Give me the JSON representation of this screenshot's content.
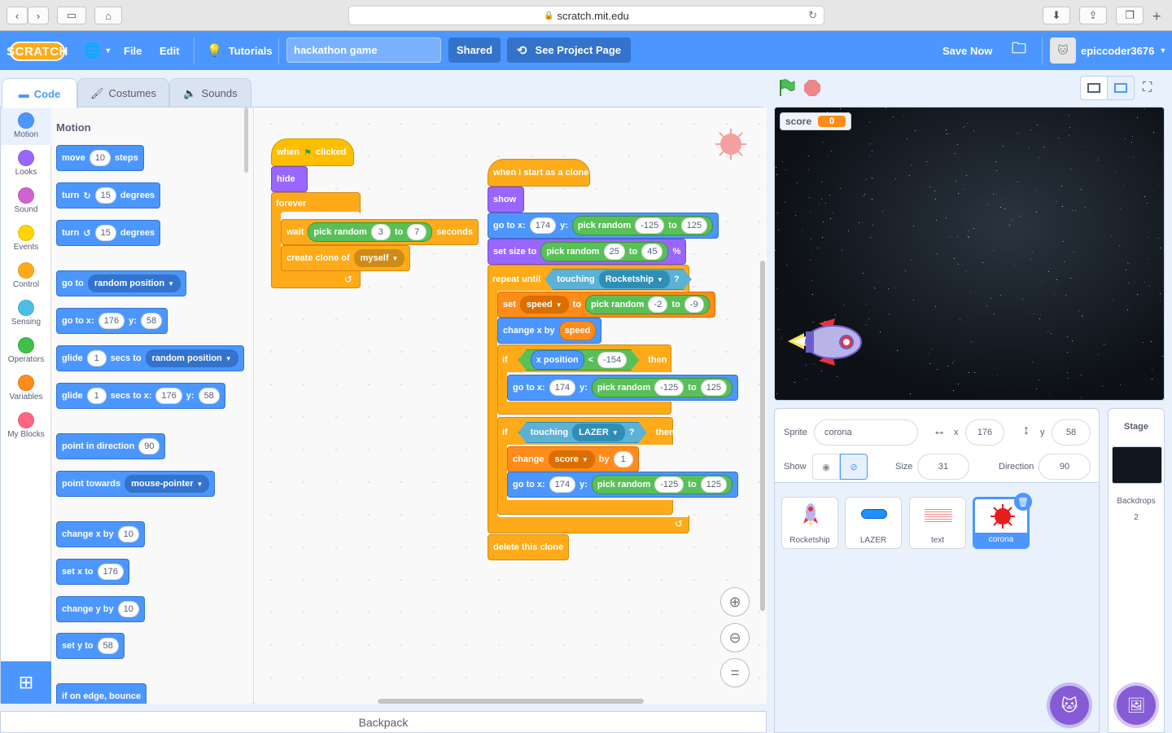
{
  "browser": {
    "url": "scratch.mit.edu"
  },
  "menu": {
    "logo": "SCRATCH",
    "file": "File",
    "edit": "Edit",
    "tutorials": "Tutorials",
    "project_title": "hackathon game",
    "shared": "Shared",
    "see_project": "See Project Page",
    "save_now": "Save Now",
    "username": "epiccoder3676"
  },
  "tabs": {
    "code": "Code",
    "costumes": "Costumes",
    "sounds": "Sounds"
  },
  "categories": [
    {
      "label": "Motion",
      "color": "#4c97ff"
    },
    {
      "label": "Looks",
      "color": "#9966ff"
    },
    {
      "label": "Sound",
      "color": "#cf63cf"
    },
    {
      "label": "Events",
      "color": "#ffd500"
    },
    {
      "label": "Control",
      "color": "#ffab19"
    },
    {
      "label": "Sensing",
      "color": "#4cbfe6"
    },
    {
      "label": "Operators",
      "color": "#40bf4a"
    },
    {
      "label": "Variables",
      "color": "#ff8c1a"
    },
    {
      "label": "My Blocks",
      "color": "#ff6680"
    }
  ],
  "palette": {
    "heading": "Motion",
    "move": "move",
    "move_val": "10",
    "steps": "steps",
    "turn": "turn",
    "deg_val": "15",
    "degrees": "degrees",
    "goto": "go to",
    "random_position": "random position",
    "gotoxy": "go to x:",
    "y": "y:",
    "x_val": "176",
    "y_val": "58",
    "glide": "glide",
    "glide_val": "1",
    "secs_to": "secs to",
    "secs_to_x": "secs to x:",
    "point_dir": "point in direction",
    "dir_val": "90",
    "point_towards": "point towards",
    "mouse_pointer": "mouse-pointer",
    "change_x": "change x by",
    "set_x": "set x to",
    "change_y": "change y by",
    "set_y": "set y to",
    "edge_bounce": "if on edge, bounce"
  },
  "script1": {
    "when": "when",
    "clicked": "clicked",
    "hide": "hide",
    "forever": "forever",
    "wait": "wait",
    "pick_random": "pick random",
    "n3": "3",
    "to": "to",
    "n7": "7",
    "seconds": "seconds",
    "create_clone": "create clone of",
    "myself": "myself"
  },
  "script2": {
    "hat": "when I start as a clone",
    "show": "show",
    "gotox": "go to x:",
    "y": "y:",
    "x174": "174",
    "pick_random": "pick random",
    "neg125": "-125",
    "to": "to",
    "p125": "125",
    "set_size": "set size to",
    "n25": "25",
    "n45": "45",
    "pct": "%",
    "repeat_until": "repeat until",
    "touching": "touching",
    "rocketship": "Rocketship",
    "q": "?",
    "set": "set",
    "speed": "speed",
    "neg2": "-2",
    "neg9": "-9",
    "change_x": "change x by",
    "if": "if",
    "x_position": "x position",
    "lt": "<",
    "neg154": "-154",
    "then": "then",
    "lazer": "LAZER",
    "change": "change",
    "score": "score",
    "by": "by",
    "one": "1",
    "delete_clone": "delete this clone"
  },
  "backpack": "Backpack",
  "stage": {
    "monitor_label": "score",
    "monitor_value": "0"
  },
  "sprite_info": {
    "sprite_label": "Sprite",
    "sprite_name": "corona",
    "x_label": "x",
    "x": "176",
    "y_label": "y",
    "y": "58",
    "show_label": "Show",
    "size_label": "Size",
    "size": "31",
    "direction_label": "Direction",
    "direction": "90"
  },
  "sprites": [
    "Rocketship",
    "LAZER",
    "text",
    "corona"
  ],
  "stage_panel": {
    "title": "Stage",
    "backdrops_label": "Backdrops",
    "backdrops_count": "2"
  }
}
